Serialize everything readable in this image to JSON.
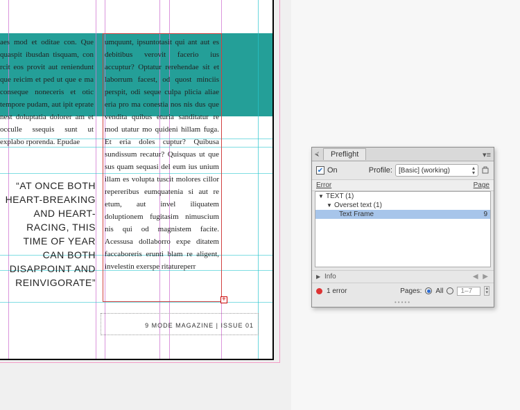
{
  "document": {
    "pullquote": "“AT ONCE BOTH HEART-BREAKING AND HEART-RACING, THIS TIME OF YEAR CAN BOTH DISAPPOINT AND REINVIGORATE”",
    "col1_text": "aes mod et oditae con. Que quaspit ibusdan tisquam, con rcit eos provit aut reniendunt que reicim et ped ut que e ma conseque noneceris et otic tempore pudam, aut ipit eprate nest doluptatia dolorer am et occulle ssequis sunt ut explabo rporenda. Epudae",
    "col2_text": "umquunt, ipsuntotasit qui ant aut es debitibus verovit facerio ius accuptur?  Optatur rerehendae sit et laborrum facest, od quost minciis perspit, odi seque culpa plicia aliae eria pro ma conestia nos nis dus que vendita quibus eturia sanditatur re mod utatur mo quideni hillam fuga. Et eria doles cuptur? Quibusa sundissum recatur? Quisquas ut que sus quam sequasi del eum ius unium illam es volupta tuscit molores cillor repereribus eumquatenia si aut re etum, aut invel iliquatem doluptionem fugitasim nimuscium nis qui od magnistem facite. Acessusa dollaborro expe ditatem faccaboreris erunti blam re aligent, invelestin exerspe ritatureperr",
    "footer": "9  MODE MAGAZINE | ISSUE 01"
  },
  "preflight": {
    "title": "Preflight",
    "on_label": "On",
    "on_checked": true,
    "profile_label": "Profile:",
    "profile_value": "[Basic] (working)",
    "col_error": "Error",
    "col_page": "Page",
    "tree": {
      "group": "TEXT (1)",
      "subgroup": "Overset text (1)",
      "item": "Text Frame",
      "item_page": "9"
    },
    "info_label": "Info",
    "error_count": "1 error",
    "pages_label": "Pages:",
    "pages_all": "All",
    "pages_range": "1–7"
  }
}
